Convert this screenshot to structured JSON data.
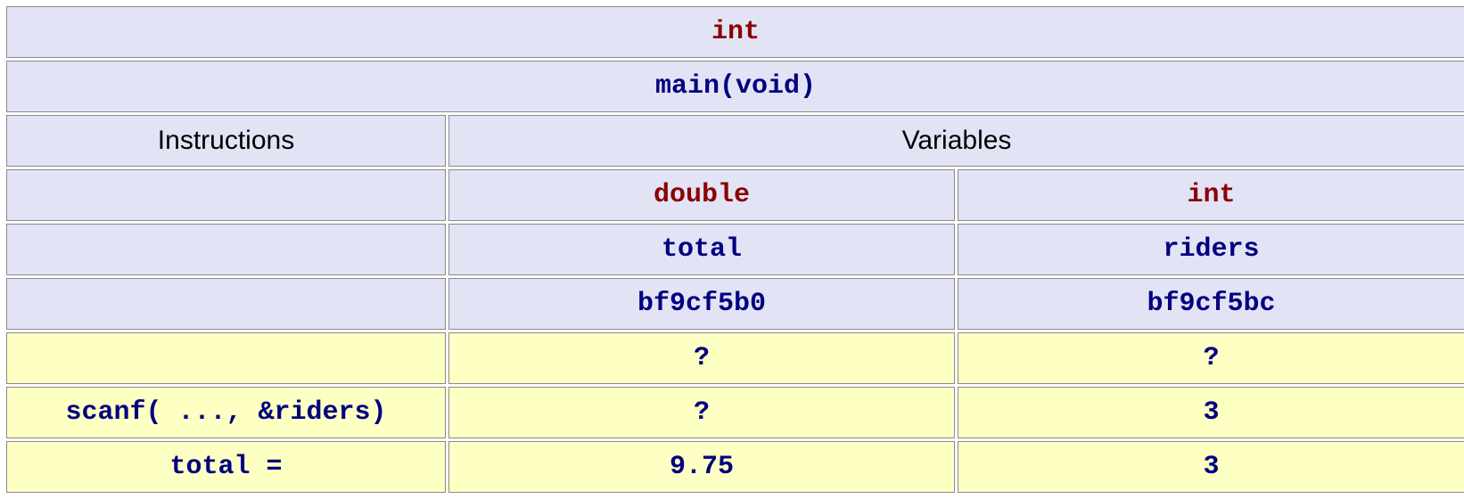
{
  "func": {
    "return_type": "int",
    "signature": "main(void)"
  },
  "columns": {
    "instructions": "Instructions",
    "variables": "Variables"
  },
  "vars": {
    "col1": {
      "type": "double",
      "name": "total",
      "address": "bf9cf5b0"
    },
    "col2": {
      "type": "int",
      "name": "riders",
      "address": "bf9cf5bc"
    }
  },
  "steps": [
    {
      "instr": "",
      "v1": "?",
      "v2": "?"
    },
    {
      "instr": "scanf( ..., &riders)",
      "v1": "?",
      "v2": "3"
    },
    {
      "instr": "total =",
      "v1": "9.75",
      "v2": "3"
    }
  ]
}
